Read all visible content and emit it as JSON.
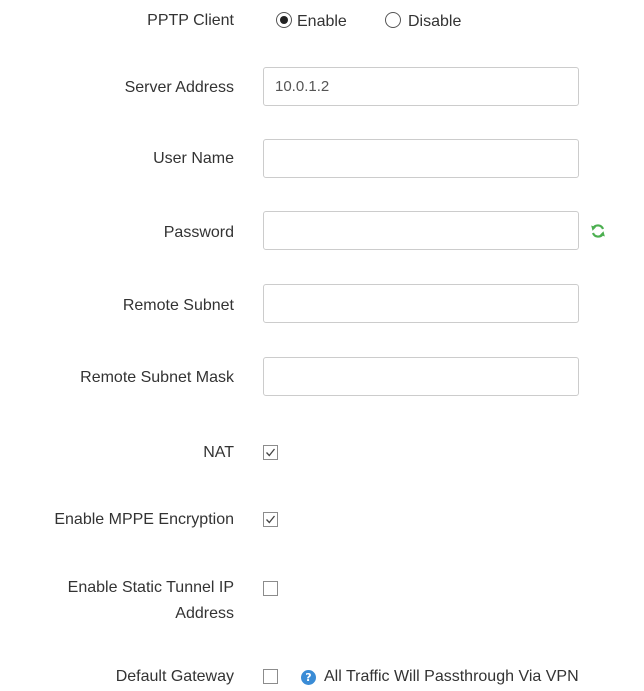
{
  "pptp_client": {
    "label": "PPTP Client",
    "options": [
      {
        "label": "Enable",
        "selected": true
      },
      {
        "label": "Disable",
        "selected": false
      }
    ]
  },
  "server_address": {
    "label": "Server Address",
    "value": "10.0.1.2"
  },
  "user_name": {
    "label": "User Name",
    "value": ""
  },
  "password": {
    "label": "Password",
    "value": "",
    "icon": "refresh-icon"
  },
  "remote_subnet": {
    "label": "Remote Subnet",
    "value": ""
  },
  "remote_subnet_mask": {
    "label": "Remote Subnet Mask",
    "value": ""
  },
  "nat": {
    "label": "NAT",
    "checked": true
  },
  "mppe": {
    "label": "Enable MPPE Encryption",
    "checked": true
  },
  "static_tunnel": {
    "label_line1": "Enable Static Tunnel IP",
    "label_line2": "Address",
    "checked": false
  },
  "default_gateway": {
    "label": "Default Gateway",
    "checked": false,
    "help_icon": "question-icon",
    "help_text": "All Traffic Will Passthrough Via VPN"
  },
  "colors": {
    "accent": "#3a8cd6",
    "refresh_icon": "#4caf50"
  }
}
